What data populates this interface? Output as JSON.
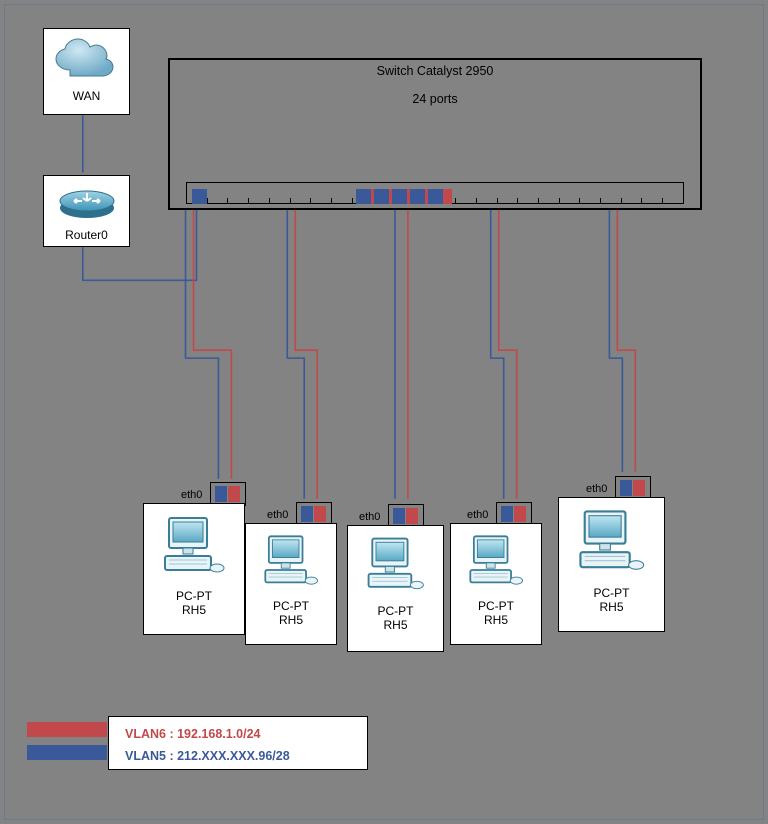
{
  "devices": {
    "wan": {
      "label": "WAN"
    },
    "router": {
      "label": "Router0"
    },
    "switch": {
      "title": "Switch Catalyst 2950",
      "ports_label": "24 ports",
      "port_count": 24
    },
    "pcs": [
      {
        "label1": "PC-PT",
        "label2": "RH5",
        "nic_label": "eth0"
      },
      {
        "label1": "PC-PT",
        "label2": "RH5",
        "nic_label": "eth0"
      },
      {
        "label1": "PC-PT",
        "label2": "RH5",
        "nic_label": "eth0"
      },
      {
        "label1": "PC-PT",
        "label2": "RH5",
        "nic_label": "eth0"
      },
      {
        "label1": "PC-PT",
        "label2": "RH5",
        "nic_label": "eth0"
      }
    ]
  },
  "legend": {
    "vlan6": "VLAN6 : 192.168.1.0/24",
    "vlan5": "VLAN5 : 212.XXX.XXX.96/28"
  },
  "colors": {
    "vlan5_blue": "#3a5998",
    "vlan6_red": "#c1494b"
  }
}
